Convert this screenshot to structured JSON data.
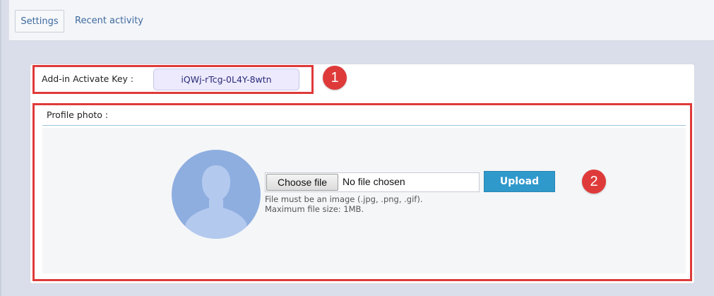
{
  "tabs": [
    {
      "label": "Settings",
      "active": true
    },
    {
      "label": "Recent activity",
      "active": false
    }
  ],
  "addin_key": {
    "label": "Add-in Activate Key :",
    "value": "iQWj-rTcg-0L4Y-8wtn"
  },
  "profile_photo": {
    "title": "Profile photo :",
    "choose_button": "Choose file",
    "no_file_text": "No file chosen",
    "upload_button": "Upload",
    "hint_format": "File must be an image (.jpg, .png, .gif).",
    "hint_size": "Maximum file size: 1MB."
  },
  "badges": [
    "1",
    "2"
  ],
  "colors": {
    "accent_red": "#df3a3a",
    "upload_blue": "#3099cc",
    "avatar_blue": "#8eaee0",
    "key_bg": "#eceafc"
  },
  "icons": {
    "avatar": "default-user-avatar-icon"
  }
}
